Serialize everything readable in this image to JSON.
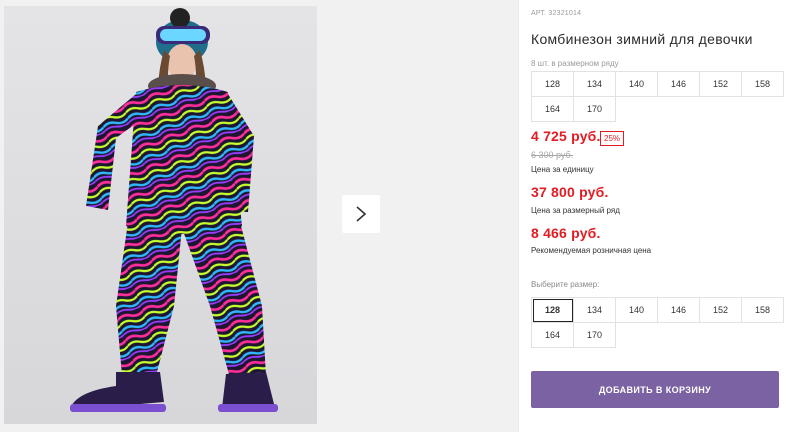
{
  "product": {
    "article": "АРТ. 32321014",
    "title": "Комбинезон зимний для девочки",
    "photo_alt": "girl-in-winter-jumpsuit"
  },
  "pack": {
    "label": "8 шт. в размерном ряду",
    "sizes": [
      "128",
      "134",
      "140",
      "146",
      "152",
      "158",
      "164",
      "170"
    ]
  },
  "prices": {
    "unit_price": "4 725 руб.",
    "discount": "25%",
    "old_price": "6 300 руб.",
    "unit_caption": "Цена за единицу",
    "pack_price": "37 800 руб.",
    "pack_caption": "Цена за размерный ряд",
    "retail_price": "8 466 руб.",
    "retail_caption": "Рекомендуемая розничная цена"
  },
  "size_select": {
    "label": "Выберите размер:",
    "sizes": [
      "128",
      "134",
      "140",
      "146",
      "152",
      "158",
      "164",
      "170"
    ],
    "selected": "128"
  },
  "cart": {
    "button_label": "ДОБАВИТЬ В КОРЗИНУ"
  },
  "gallery": {
    "next_icon": "chevron-right-icon"
  },
  "colors": {
    "accent": "#7b63a3",
    "price": "#e31b23"
  }
}
